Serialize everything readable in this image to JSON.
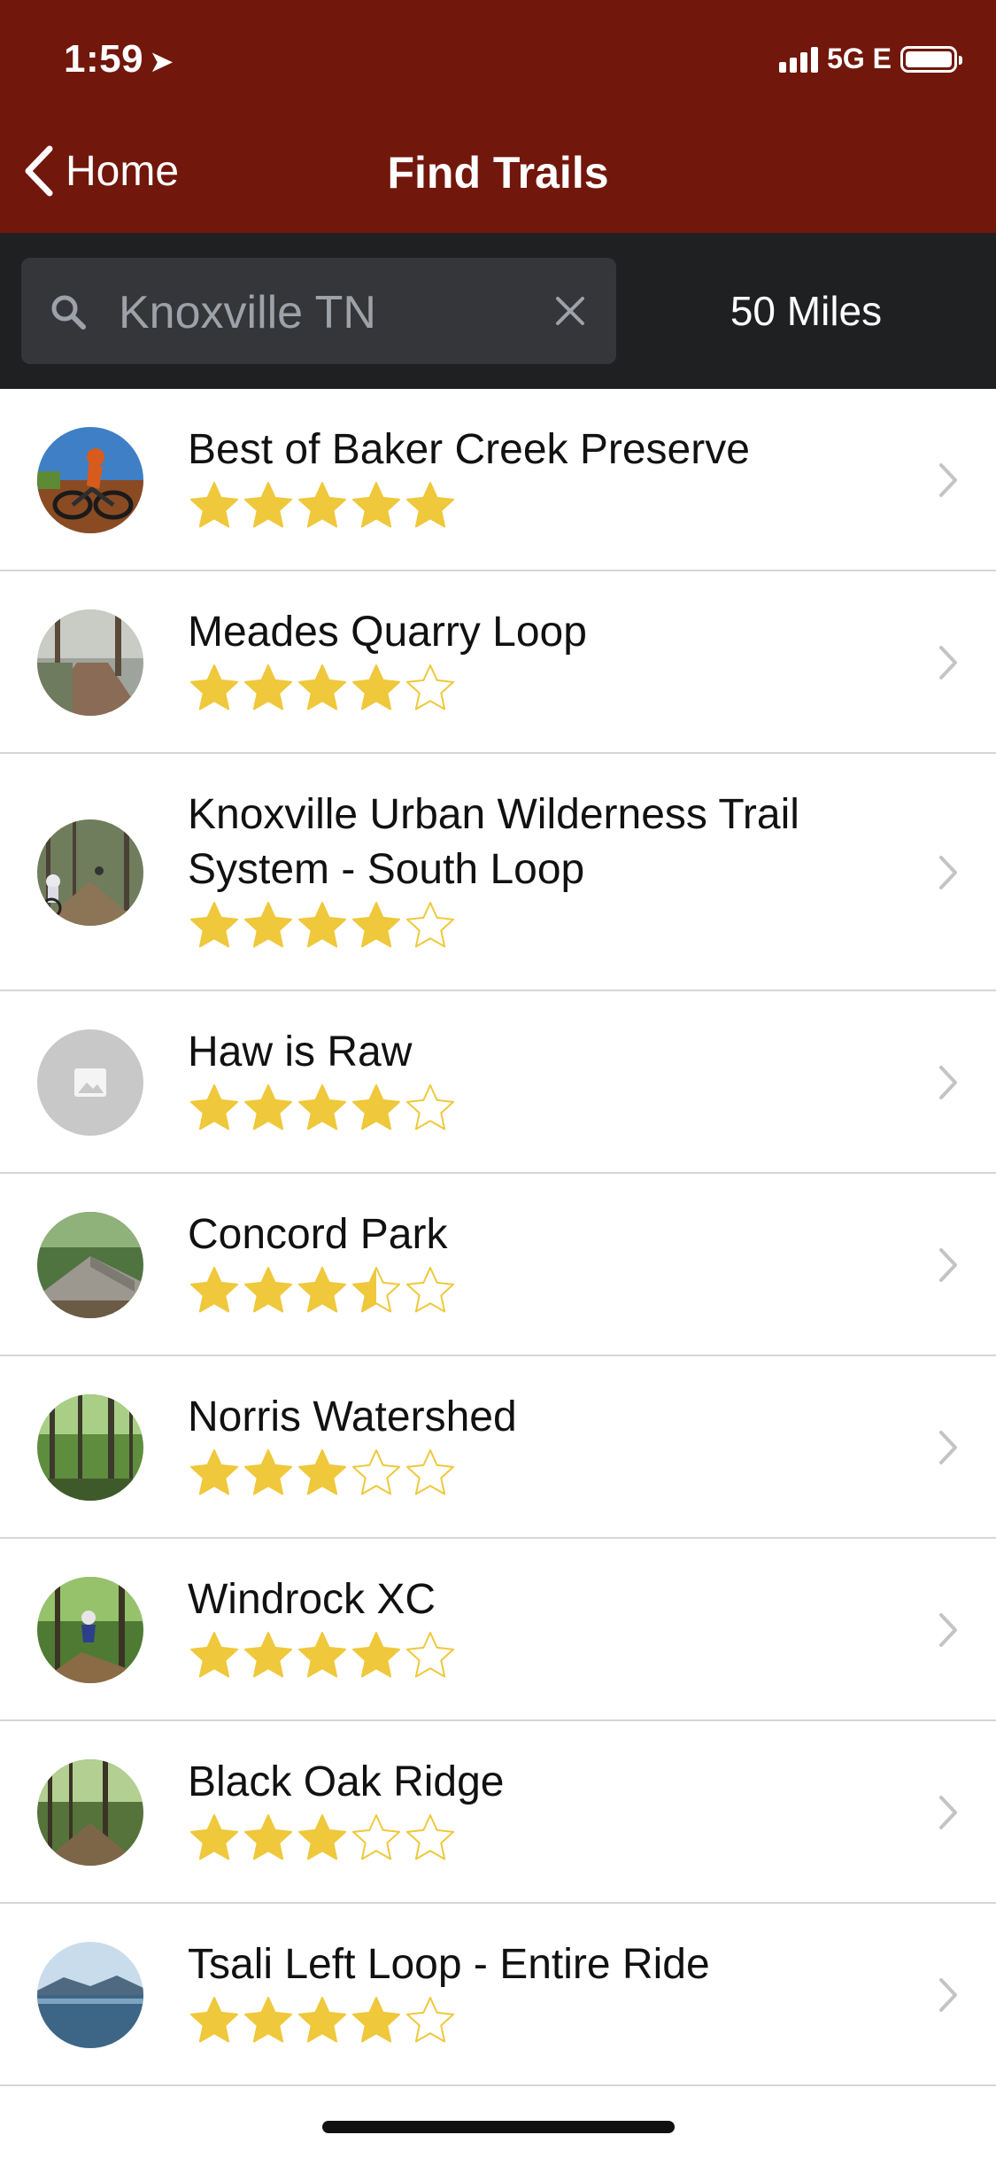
{
  "status_bar": {
    "time": "1:59",
    "network": "5G E"
  },
  "nav": {
    "back_label": "Home",
    "title": "Find Trails"
  },
  "search": {
    "value": "Knoxville TN",
    "radius": "50 Miles"
  },
  "colors": {
    "header": "#72170c",
    "search_bar": "#1f2022",
    "star": "#efc83b"
  },
  "trails": [
    {
      "name": "Best of Baker Creek Preserve",
      "rating": 5,
      "photo": "mountain-bike-rider"
    },
    {
      "name": "Meades Quarry Loop",
      "rating": 4,
      "photo": "forest-trail"
    },
    {
      "name": "Knoxville Urban Wilderness Trail System - South Loop",
      "rating": 4,
      "photo": "forest-riders"
    },
    {
      "name": "Haw is Raw",
      "rating": 4,
      "photo": "image-placeholder-icon"
    },
    {
      "name": "Concord Park",
      "rating": 3.5,
      "photo": "rock-ramp-trail"
    },
    {
      "name": "Norris Watershed",
      "rating": 3,
      "photo": "forest"
    },
    {
      "name": "Windrock XC",
      "rating": 4,
      "photo": "rider-jump"
    },
    {
      "name": "Black Oak Ridge",
      "rating": 3,
      "photo": "forest-trail"
    },
    {
      "name": "Tsali Left Loop - Entire Ride",
      "rating": 4,
      "photo": "lake"
    }
  ]
}
